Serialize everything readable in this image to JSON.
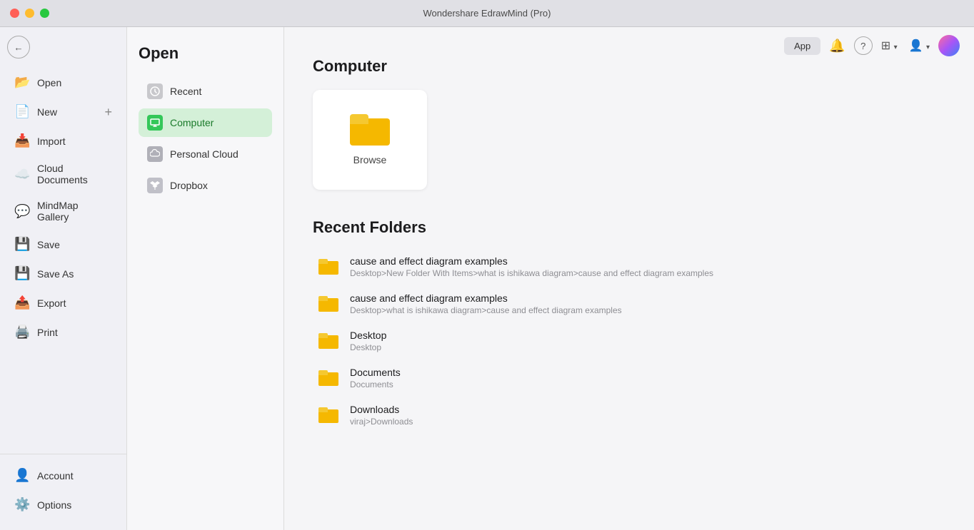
{
  "titlebar": {
    "title": "Wondershare EdrawMind (Pro)"
  },
  "sidebar": {
    "items": [
      {
        "label": "Open",
        "icon": "📂",
        "icon_class": "icon-green"
      },
      {
        "label": "New",
        "icon": "📄",
        "icon_class": "icon-blue",
        "has_plus": true
      },
      {
        "label": "Import",
        "icon": "📥",
        "icon_class": "icon-blue"
      },
      {
        "label": "Cloud Documents",
        "icon": "☁️",
        "icon_class": "icon-blue"
      },
      {
        "label": "MindMap Gallery",
        "icon": "💬",
        "icon_class": "icon-blue"
      },
      {
        "label": "Save",
        "icon": "💾",
        "icon_class": "icon-gray"
      },
      {
        "label": "Save As",
        "icon": "💾",
        "icon_class": "icon-blue"
      },
      {
        "label": "Export",
        "icon": "📤",
        "icon_class": "icon-orange"
      },
      {
        "label": "Print",
        "icon": "🖨️",
        "icon_class": "icon-gray"
      }
    ],
    "bottom_items": [
      {
        "label": "Account",
        "icon": "👤"
      },
      {
        "label": "Options",
        "icon": "⚙️"
      }
    ]
  },
  "panel": {
    "title": "Open",
    "items": [
      {
        "label": "Recent",
        "icon_type": "gray"
      },
      {
        "label": "Computer",
        "icon_type": "green",
        "active": true
      },
      {
        "label": "Personal Cloud",
        "icon_type": "cloud"
      },
      {
        "label": "Dropbox",
        "icon_type": "dropbox"
      }
    ]
  },
  "main": {
    "computer_title": "Computer",
    "browse_label": "Browse",
    "recent_folders_title": "Recent Folders",
    "folders": [
      {
        "name": "cause and effect diagram examples",
        "path": "Desktop>New Folder With Items>what is ishikawa diagram>cause and effect diagram examples"
      },
      {
        "name": "cause and effect diagram examples",
        "path": "Desktop>what is ishikawa diagram>cause and effect diagram examples"
      },
      {
        "name": "Desktop",
        "path": "Desktop"
      },
      {
        "name": "Documents",
        "path": "Documents"
      },
      {
        "name": "Downloads",
        "path": "viraj>Downloads"
      }
    ]
  },
  "topbar": {
    "app_label": "App",
    "notification_icon": "🔔",
    "help_icon": "?",
    "grid_icon": "⊞",
    "user_icon": "👤"
  }
}
